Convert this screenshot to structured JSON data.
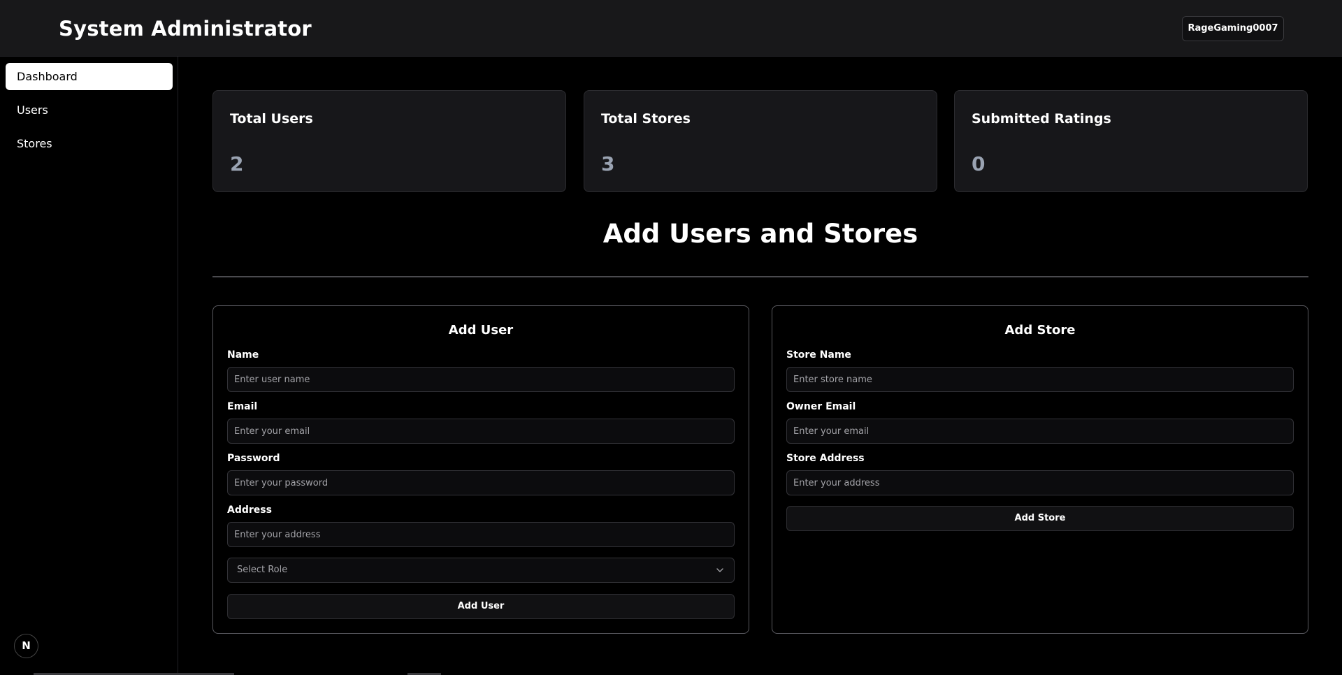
{
  "header": {
    "title": "System Administrator",
    "user_label": "RageGaming0007"
  },
  "sidebar": {
    "items": [
      {
        "label": "Dashboard",
        "active": true
      },
      {
        "label": "Users",
        "active": false
      },
      {
        "label": "Stores",
        "active": false
      }
    ],
    "badge": "N"
  },
  "stats": [
    {
      "label": "Total Users",
      "value": "2"
    },
    {
      "label": "Total Stores",
      "value": "3"
    },
    {
      "label": "Submitted Ratings",
      "value": "0"
    }
  ],
  "section": {
    "title": "Add Users and Stores"
  },
  "add_user": {
    "title": "Add User",
    "name_label": "Name",
    "name_placeholder": "Enter user name",
    "email_label": "Email",
    "email_placeholder": "Enter your email",
    "password_label": "Password",
    "password_placeholder": "Enter your password",
    "address_label": "Address",
    "address_placeholder": "Enter your address",
    "role_placeholder": "Select Role",
    "submit_label": "Add User"
  },
  "add_store": {
    "title": "Add Store",
    "name_label": "Store Name",
    "name_placeholder": "Enter store name",
    "email_label": "Owner Email",
    "email_placeholder": "Enter your email",
    "address_label": "Store Address",
    "address_placeholder": "Enter your address",
    "submit_label": "Add Store"
  },
  "colors": {
    "background": "#000000",
    "header": "#18181a",
    "card": "#17171a",
    "stat_value": "#9aa3b2",
    "active_nav": "#ffffff"
  }
}
